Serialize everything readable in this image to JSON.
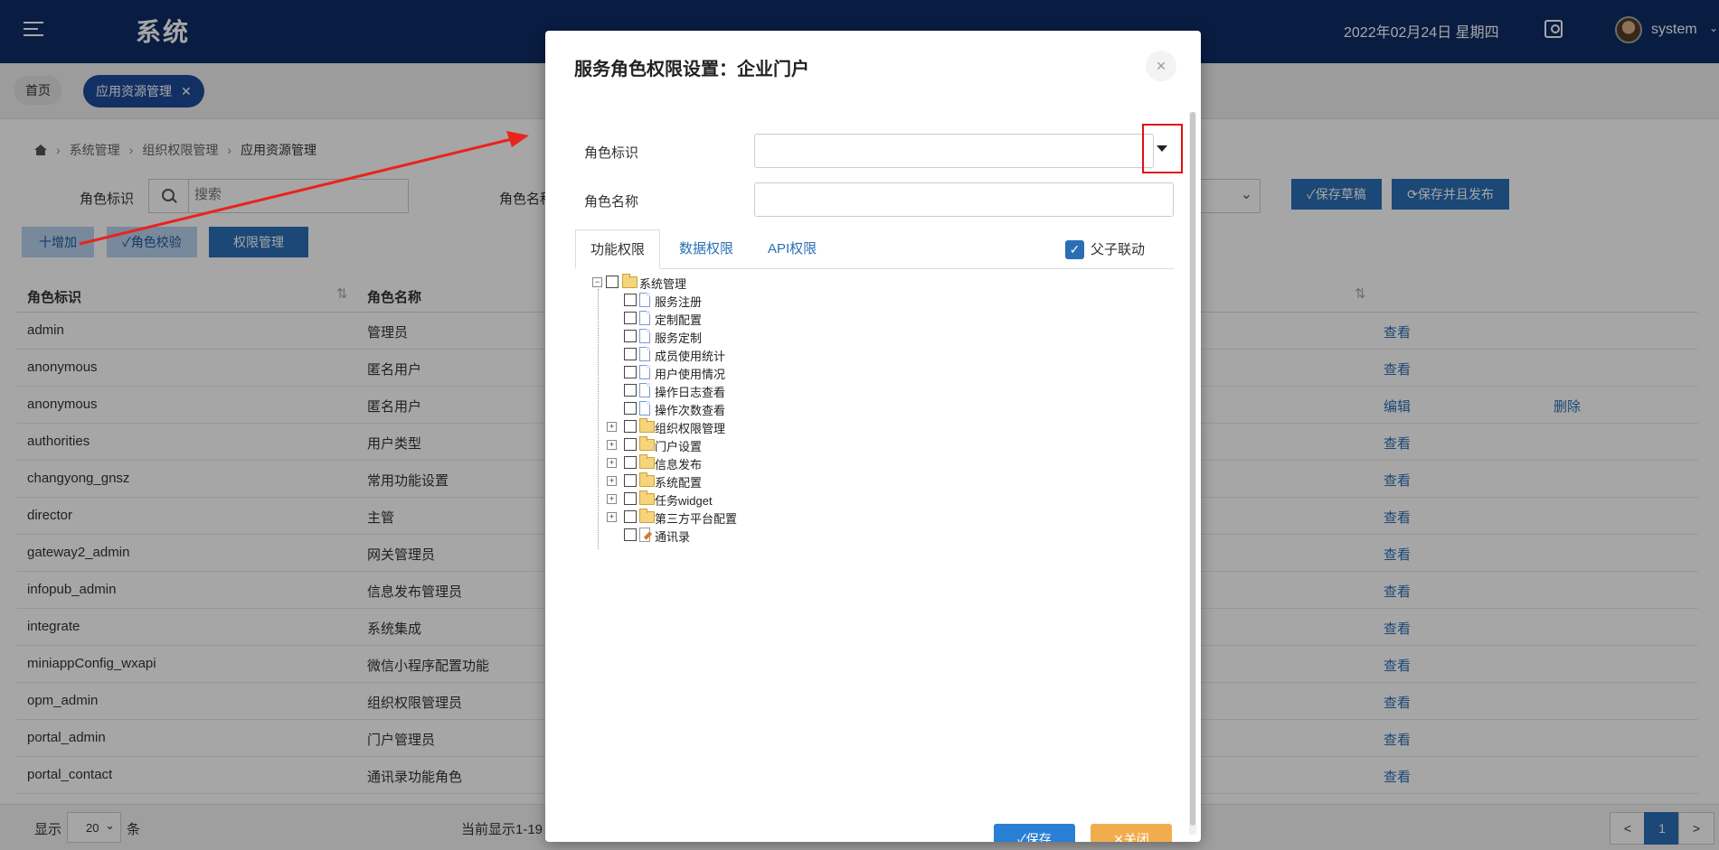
{
  "header": {
    "title": "系统",
    "date": "2022年02月24日 星期四",
    "user": "system"
  },
  "tabs": {
    "home": "首页",
    "active": "应用资源管理"
  },
  "breadcrumb": [
    "系统管理",
    "组织权限管理",
    "应用资源管理"
  ],
  "search": {
    "role_id_label": "角色标识",
    "placeholder": "搜索",
    "role_name_label": "角色名称"
  },
  "toolbar": {
    "add": "十增加",
    "check": "✓角色校验",
    "perm": "权限管理",
    "save_draft": "✓保存草稿",
    "save_publish": "⟳保存并且发布"
  },
  "table": {
    "headers": [
      "角色标识",
      "角色名称"
    ],
    "rows": [
      {
        "id": "admin",
        "name": "管理员",
        "action": "查看",
        "action2": ""
      },
      {
        "id": "anonymous",
        "name": "匿名用户",
        "action": "查看",
        "action2": ""
      },
      {
        "id": "anonymous",
        "name": "匿名用户",
        "action": "编辑",
        "action2": "删除"
      },
      {
        "id": "authorities",
        "name": "用户类型",
        "action": "查看",
        "action2": ""
      },
      {
        "id": "changyong_gnsz",
        "name": "常用功能设置",
        "action": "查看",
        "action2": ""
      },
      {
        "id": "director",
        "name": "主管",
        "action": "查看",
        "action2": ""
      },
      {
        "id": "gateway2_admin",
        "name": "网关管理员",
        "action": "查看",
        "action2": ""
      },
      {
        "id": "infopub_admin",
        "name": "信息发布管理员",
        "action": "查看",
        "action2": ""
      },
      {
        "id": "integrate",
        "name": "系统集成",
        "action": "查看",
        "action2": ""
      },
      {
        "id": "miniappConfig_wxapi",
        "name": "微信小程序配置功能",
        "action": "查看",
        "action2": ""
      },
      {
        "id": "opm_admin",
        "name": "组织权限管理员",
        "action": "查看",
        "action2": ""
      },
      {
        "id": "portal_admin",
        "name": "门户管理员",
        "action": "查看",
        "action2": ""
      },
      {
        "id": "portal_contact",
        "name": "通讯录功能角色",
        "action": "查看",
        "action2": ""
      }
    ]
  },
  "footer": {
    "show": "显示",
    "page_size": "20",
    "unit": "条",
    "info": "当前显示1-19",
    "prev": "<",
    "page": "1",
    "next": ">"
  },
  "modal": {
    "title": "服务角色权限设置：企业门户",
    "close": "×",
    "role_id_label": "角色标识",
    "role_id_value": "",
    "role_name_label": "角色名称",
    "role_name_value": "",
    "tabs": [
      "功能权限",
      "数据权限",
      "API权限"
    ],
    "linkage_label": "父子联动",
    "linkage_checked": true,
    "tree": {
      "root": "系统管理",
      "children": [
        "服务注册",
        "定制配置",
        "服务定制",
        "成员使用统计",
        "用户使用情况",
        "操作日志查看",
        "操作次数查看"
      ],
      "folders": [
        "组织权限管理",
        "门户设置",
        "信息发布",
        "系统配置",
        "任务widget",
        "第三方平台配置"
      ],
      "last": "通讯录"
    },
    "save": "✓保存",
    "close_btn": "✕关闭"
  },
  "colors": {
    "header_bg": "#0e2c66",
    "primary": "#2a6fb5",
    "highlight_box": "#e01010",
    "close_btn": "#f0ad4e"
  }
}
